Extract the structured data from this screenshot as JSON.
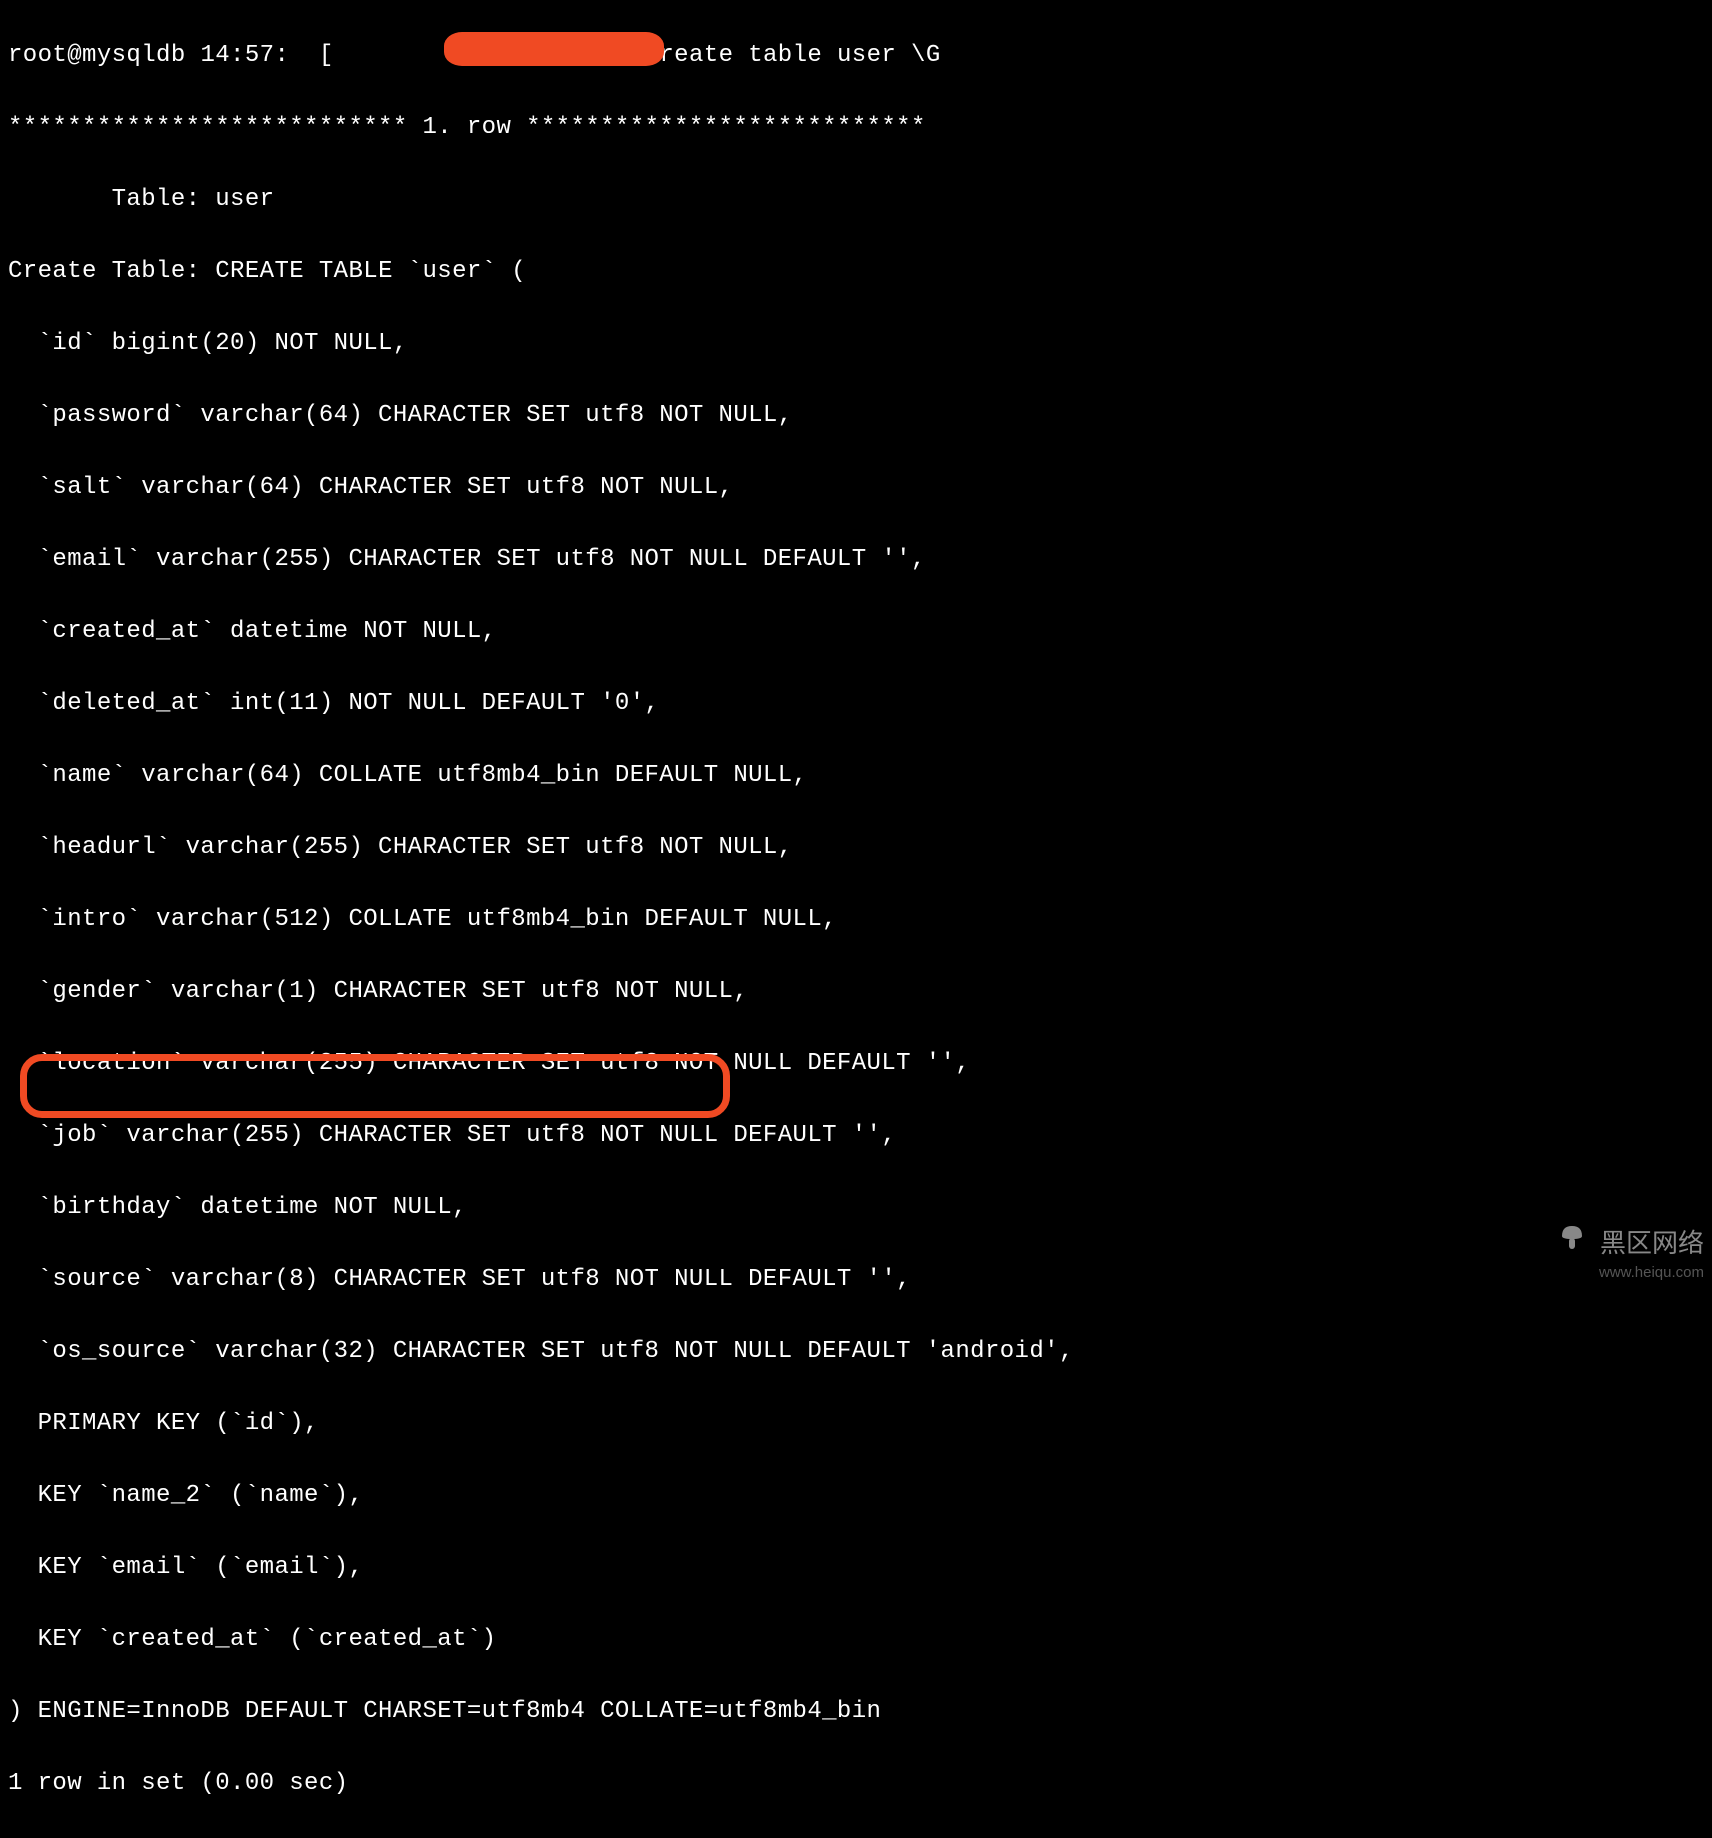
{
  "prompt": {
    "user_host": "root@mysqldb",
    "time": "14:57:",
    "bracket_open": "[",
    "bracket_close": "]>",
    "command": "show create table user \\G"
  },
  "row_sep": "*************************** 1. row ***************************",
  "table_label": "       Table:",
  "table_name": "user",
  "create_label": "Create Table:",
  "create_head": "CREATE TABLE `user` (",
  "cols": [
    "  `id` bigint(20) NOT NULL,",
    "  `password` varchar(64) CHARACTER SET utf8 NOT NULL,",
    "  `salt` varchar(64) CHARACTER SET utf8 NOT NULL,",
    "  `email` varchar(255) CHARACTER SET utf8 NOT NULL DEFAULT '',",
    "  `created_at` datetime NOT NULL,",
    "  `deleted_at` int(11) NOT NULL DEFAULT '0',",
    "  `name` varchar(64) COLLATE utf8mb4_bin DEFAULT NULL,",
    "  `headurl` varchar(255) CHARACTER SET utf8 NOT NULL,",
    "  `intro` varchar(512) COLLATE utf8mb4_bin DEFAULT NULL,",
    "  `gender` varchar(1) CHARACTER SET utf8 NOT NULL,",
    "  `location` varchar(255) CHARACTER SET utf8 NOT NULL DEFAULT '',",
    "  `job` varchar(255) CHARACTER SET utf8 NOT NULL DEFAULT '',",
    "  `birthday` datetime NOT NULL,",
    "  `source` varchar(8) CHARACTER SET utf8 NOT NULL DEFAULT '',",
    "  `os_source` varchar(32) CHARACTER SET utf8 NOT NULL DEFAULT 'android',",
    "  PRIMARY KEY (`id`),",
    "  KEY `name_2` (`name`),",
    "  KEY `email` (`email`),",
    "  KEY `created_at` (`created_at`)"
  ],
  "table_tail": ") ENGINE=InnoDB DEFAULT CHARSET=utf8mb4 COLLATE=utf8mb4_bin",
  "footer": "1 row in set (0.00 sec)",
  "watermark": {
    "title": "黑区网络",
    "url": "www.heiqu.com"
  }
}
